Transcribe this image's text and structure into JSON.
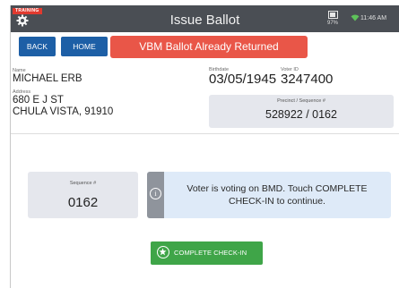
{
  "header": {
    "badge": "TRAINING",
    "title": "Issue Ballot",
    "battery": "97%",
    "time": "11:46 AM"
  },
  "toolbar": {
    "back_label": "BACK",
    "home_label": "HOME",
    "alert_text": "VBM Ballot Already Returned"
  },
  "voter": {
    "name_label": "Name",
    "name": "MICHAEL ERB",
    "address_label": "Address",
    "address_line1": "680 E J ST",
    "address_line2": "CHULA VISTA, 91910",
    "birthdate_label": "Birthdate",
    "birthdate": "03/05/1945",
    "voter_id_label": "Voter ID",
    "voter_id": "3247400",
    "precinct_label": "Precinct / Sequence #",
    "precinct": "528922 / 0162"
  },
  "sequence": {
    "label": "Sequence #",
    "value": "0162"
  },
  "info": {
    "message": "Voter is voting on BMD. Touch COMPLETE CHECK-IN to continue."
  },
  "actions": {
    "complete_label": "COMPLETE CHECK-IN"
  },
  "colors": {
    "topbar": "#4a4e54",
    "primary_blue": "#1d5fa6",
    "alert_red": "#e95648",
    "success_green": "#3fa548",
    "panel_gray": "#e5e7ed",
    "info_blue": "#deeaf8"
  },
  "icons": {
    "settings": "gear-icon",
    "battery": "battery-icon",
    "wifi": "wifi-icon",
    "info": "info-icon",
    "complete": "star-icon"
  }
}
